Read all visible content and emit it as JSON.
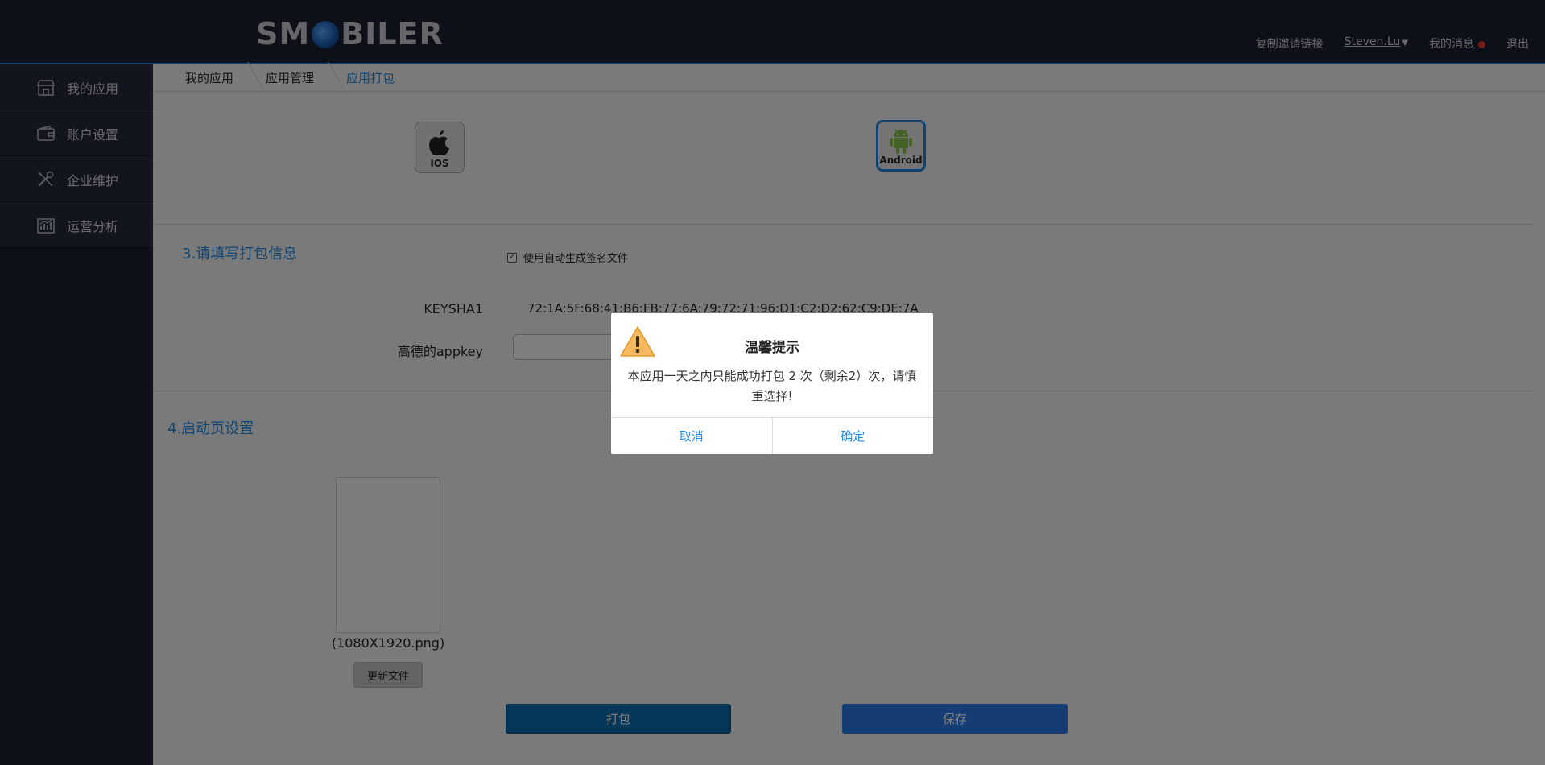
{
  "header": {
    "logo_left": "SM",
    "logo_right": "BILER",
    "nav": {
      "copy_invite": "复制邀请链接",
      "user": "Steven.Lu",
      "messages": "我的消息",
      "logout": "退出"
    }
  },
  "sidebar": {
    "items": [
      {
        "label": "我的应用",
        "icon": "store-icon"
      },
      {
        "label": "账户设置",
        "icon": "wallet-icon"
      },
      {
        "label": "企业维护",
        "icon": "tools-icon"
      },
      {
        "label": "运营分析",
        "icon": "chart-icon"
      }
    ]
  },
  "breadcrumb": [
    "我的应用",
    "应用管理",
    "应用打包"
  ],
  "platforms": {
    "ios_label": "IOS",
    "android_label": "Android"
  },
  "section3": {
    "title": "3.请填写打包信息",
    "auto_sign_label": "使用自动生成签名文件",
    "auto_sign_checked": true,
    "keysha1_label": "KEYSHA1",
    "keysha1_value": "72:1A:5F:68:41:B6:FB:77:6A:79:72:71:96:D1:C2:D2:62:C9:DE:7A",
    "appkey_label": "高德的appkey",
    "appkey_value": ""
  },
  "section4": {
    "title": "4.启动页设置",
    "splash_caption": "(1080X1920.png)",
    "update_button": "更新文件"
  },
  "actions": {
    "pack": "打包",
    "save": "保存"
  },
  "modal": {
    "title": "温馨提示",
    "message": "本应用一天之内只能成功打包 2 次（剩余2）次，请慎重选择!",
    "cancel": "取消",
    "confirm": "确定"
  },
  "colors": {
    "header_bg": "#1b2030",
    "accent": "#1e88e5",
    "save_button": "#2b7ae8",
    "pack_button": "#0b6fb0",
    "notification_dot": "#e53935"
  }
}
